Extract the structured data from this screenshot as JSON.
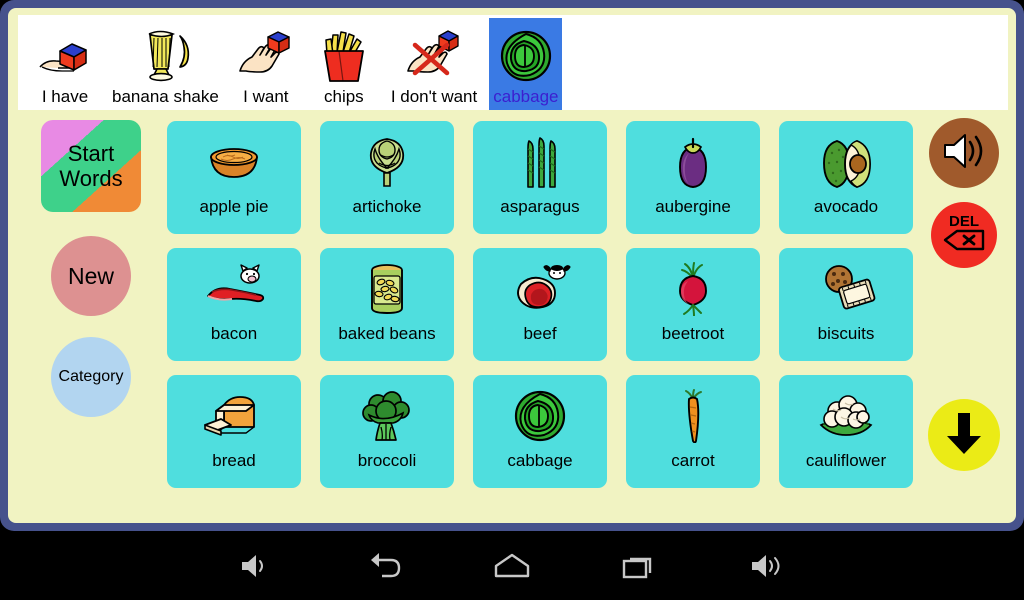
{
  "app": {
    "frame_color": "#46528c",
    "surface_color": "#f1f3c2"
  },
  "sentence_bar": {
    "background": "#ffffff",
    "selected_background": "#3a7ae4",
    "selected_text_color": "#3b1fd0",
    "items": [
      {
        "label": "I have",
        "icon": "hand-holding-cube-icon",
        "selected": false
      },
      {
        "label": "banana shake",
        "icon": "milkshake-banana-icon",
        "selected": false
      },
      {
        "label": "I want",
        "icon": "open-hand-cube-icon",
        "selected": false
      },
      {
        "label": "chips",
        "icon": "fries-icon",
        "selected": false
      },
      {
        "label": "I don't want",
        "icon": "crossed-hand-cube-icon",
        "selected": false
      },
      {
        "label": "cabbage",
        "icon": "cabbage-icon",
        "selected": true
      }
    ]
  },
  "left_rail": {
    "start_words": {
      "line1": "Start",
      "line2": "Words",
      "colors": [
        "#e88ae4",
        "#3ed18a",
        "#f08a36"
      ]
    },
    "new_button": {
      "label": "New",
      "color": "#dd9191"
    },
    "category_button": {
      "label": "Category",
      "color": "#b2d5f0"
    }
  },
  "right_rail": {
    "speak_button": {
      "icon": "speaker-icon",
      "color": "#a05a2c"
    },
    "delete_button": {
      "label": "DEL",
      "icon": "backspace-x-icon",
      "color": "#f02b22"
    },
    "scroll_down_button": {
      "icon": "arrow-down-icon",
      "color": "#ebeb16"
    }
  },
  "word_grid": {
    "tile_color": "#4fdede",
    "columns": 5,
    "rows": 3,
    "tiles": [
      {
        "label": "apple pie",
        "icon": "apple-pie-icon"
      },
      {
        "label": "artichoke",
        "icon": "artichoke-icon"
      },
      {
        "label": "asparagus",
        "icon": "asparagus-icon"
      },
      {
        "label": "aubergine",
        "icon": "aubergine-icon"
      },
      {
        "label": "avocado",
        "icon": "avocado-icon"
      },
      {
        "label": "bacon",
        "icon": "bacon-icon"
      },
      {
        "label": "baked beans",
        "icon": "baked-beans-can-icon"
      },
      {
        "label": "beef",
        "icon": "beef-icon"
      },
      {
        "label": "beetroot",
        "icon": "beetroot-icon"
      },
      {
        "label": "biscuits",
        "icon": "biscuits-icon"
      },
      {
        "label": "bread",
        "icon": "bread-icon"
      },
      {
        "label": "broccoli",
        "icon": "broccoli-icon"
      },
      {
        "label": "cabbage",
        "icon": "cabbage-icon"
      },
      {
        "label": "carrot",
        "icon": "carrot-icon"
      },
      {
        "label": "cauliflower",
        "icon": "cauliflower-icon"
      }
    ]
  },
  "nav_bar": {
    "buttons": [
      {
        "icon": "volume-down-icon"
      },
      {
        "icon": "back-icon"
      },
      {
        "icon": "home-icon"
      },
      {
        "icon": "recents-icon"
      },
      {
        "icon": "volume-up-icon"
      }
    ]
  }
}
